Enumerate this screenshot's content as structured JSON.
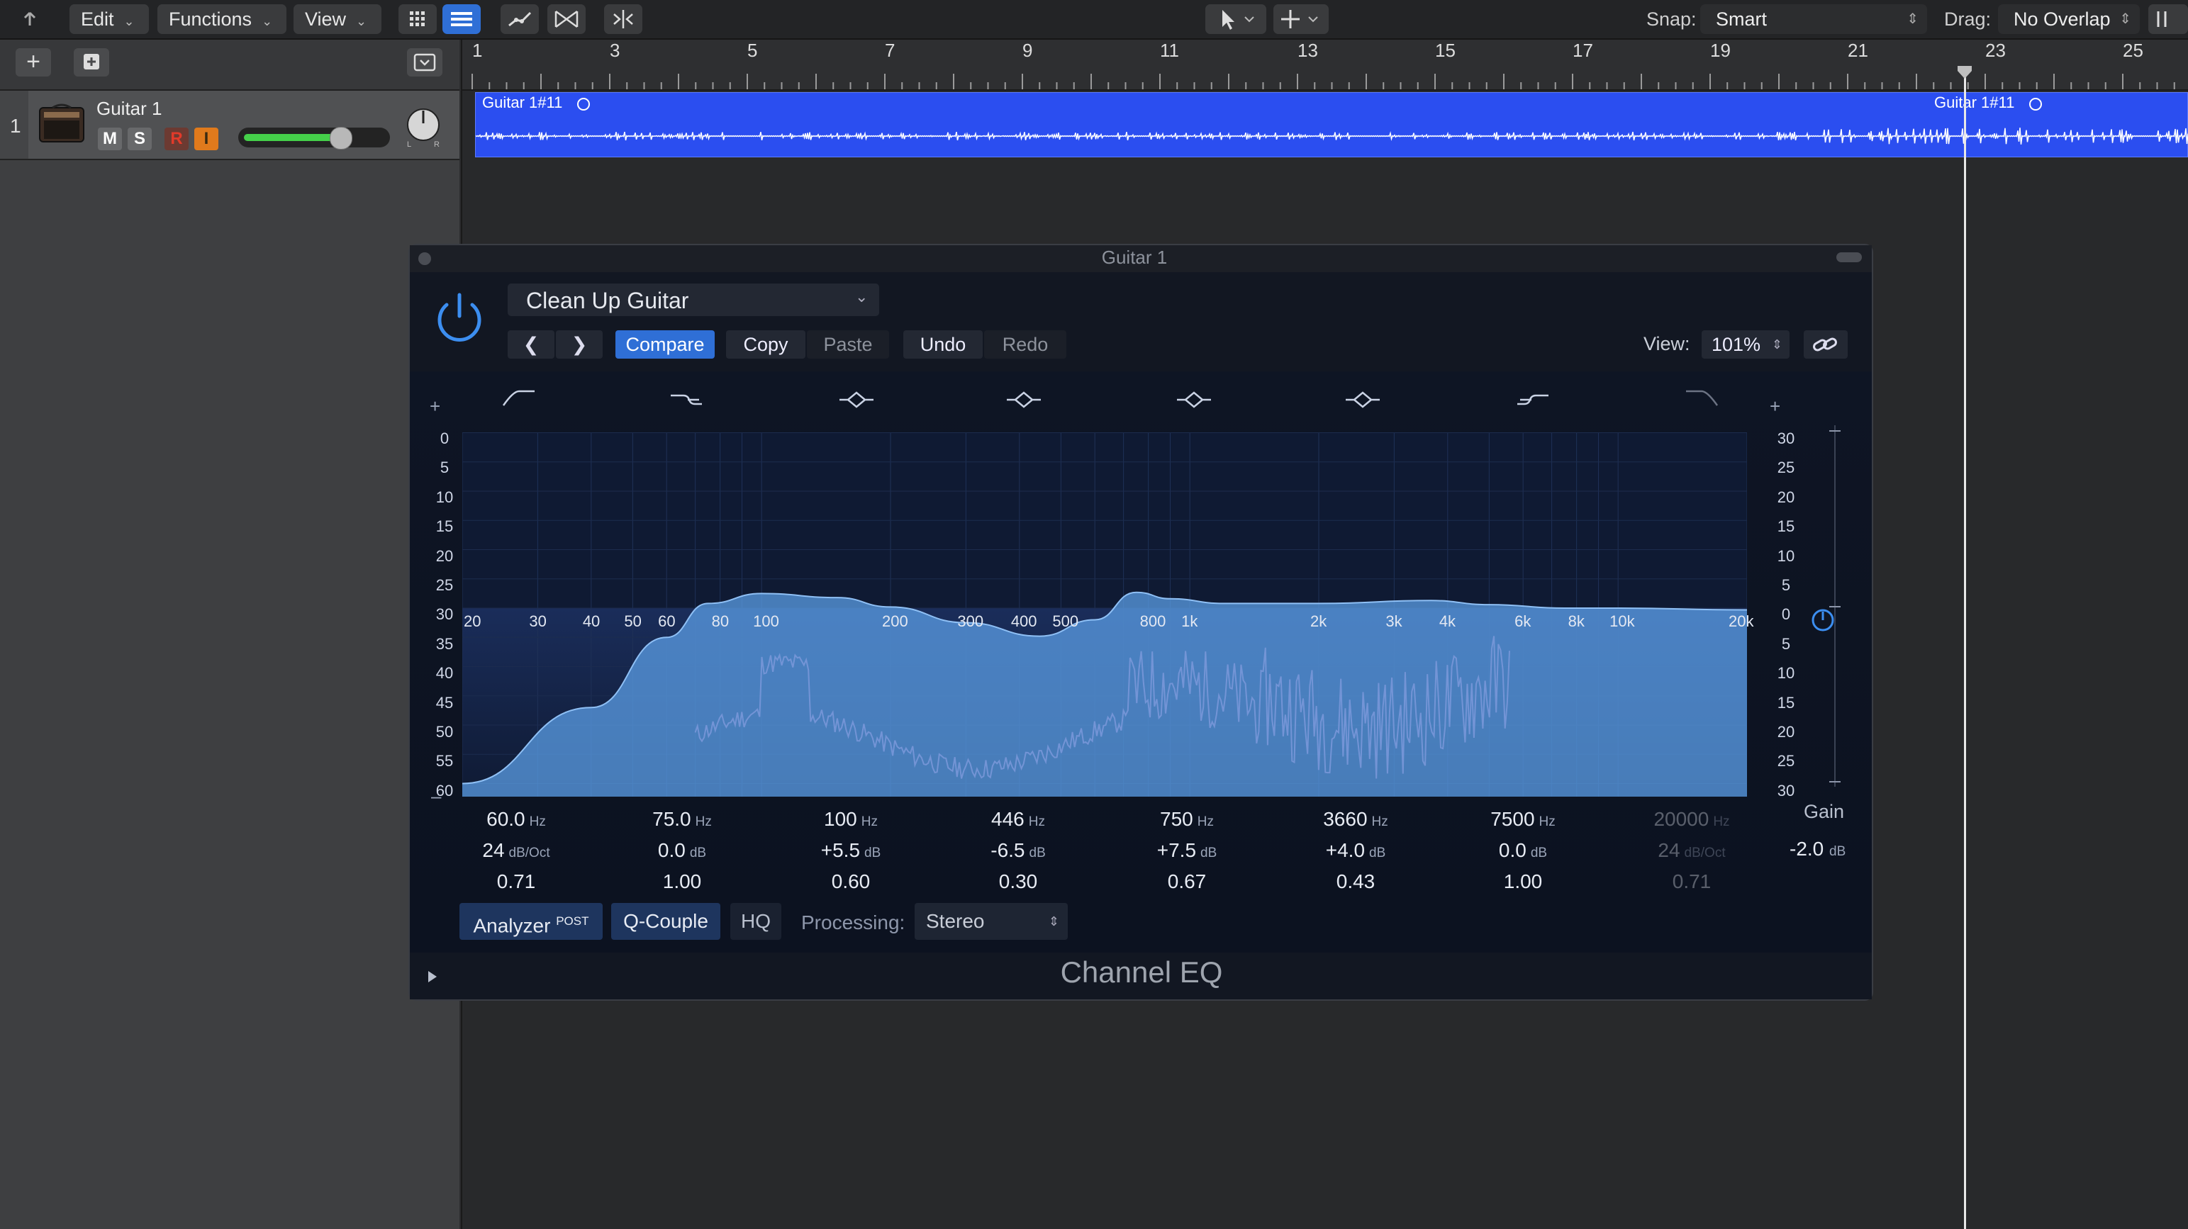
{
  "menubar": {
    "edit_label": "Edit",
    "functions_label": "Functions",
    "view_label": "View",
    "snap_label": "Snap:",
    "snap_value": "Smart",
    "drag_label": "Drag:",
    "drag_value": "No Overlap"
  },
  "ruler": {
    "bars": [
      "1",
      "3",
      "5",
      "7",
      "9",
      "11",
      "13",
      "15",
      "17",
      "19",
      "21",
      "23",
      "25"
    ]
  },
  "track": {
    "number": "1",
    "name": "Guitar 1",
    "mute": "M",
    "solo": "S",
    "record": "R",
    "input": "I",
    "volume_fraction": 0.72,
    "pan_label_l": "L",
    "pan_label_r": "R"
  },
  "region": {
    "name_a": "Guitar 1#11",
    "name_b": "Guitar 1#11",
    "color": "#2b4ef0"
  },
  "plugin": {
    "window_title": "Guitar 1",
    "preset_name": "Clean Up Guitar",
    "compare_label": "Compare",
    "copy_label": "Copy",
    "paste_label": "Paste",
    "undo_label": "Undo",
    "redo_label": "Redo",
    "view_label": "View:",
    "view_value": "101%",
    "plugin_name": "Channel EQ",
    "gain_label": "Gain",
    "gain_value": "-2.0",
    "gain_unit": "dB",
    "plus_left": "+",
    "plus_right": "+",
    "minus_left": "–",
    "accent_color": "#2f6fd6",
    "curve_color": "#5b9ee6",
    "analyzer_color": "#d98ab8"
  },
  "chart_data": {
    "type": "line",
    "title": "",
    "xlabel": "",
    "ylabel": "",
    "x_scale": "log",
    "x_ticks": [
      "20",
      "30",
      "40",
      "50",
      "60",
      "80",
      "100",
      "200",
      "300",
      "400",
      "500",
      "800",
      "1k",
      "2k",
      "3k",
      "4k",
      "6k",
      "8k",
      "10k",
      "20k"
    ],
    "left_y_ticks": [
      "0",
      "5",
      "10",
      "15",
      "20",
      "25",
      "30",
      "35",
      "40",
      "45",
      "50",
      "55",
      "60"
    ],
    "right_y_ticks": [
      "30",
      "25",
      "20",
      "15",
      "10",
      "5",
      "0",
      "5",
      "10",
      "15",
      "20",
      "25",
      "30"
    ],
    "right_y_range_db": [
      -30,
      30
    ],
    "series": [
      {
        "x": [
          20,
          40,
          60,
          75,
          100,
          150,
          200,
          300,
          446,
          600,
          750,
          900,
          1200,
          2000,
          3660,
          5000,
          7500,
          10000,
          20000
        ],
        "y": [
          -30,
          -17,
          -5,
          0.8,
          2.5,
          1.8,
          0.2,
          -2.5,
          -4.8,
          -2.0,
          2.7,
          1.6,
          0.8,
          0.8,
          1.3,
          0.6,
          0,
          0,
          -0.3
        ]
      }
    ]
  },
  "bands": [
    {
      "freq": "60.0",
      "freq_unit": "Hz",
      "gain": "24",
      "gain_unit": "dB/Oct",
      "q": "0.71",
      "active": true
    },
    {
      "freq": "75.0",
      "freq_unit": "Hz",
      "gain": "0.0",
      "gain_unit": "dB",
      "q": "1.00",
      "active": true
    },
    {
      "freq": "100",
      "freq_unit": "Hz",
      "gain": "+5.5",
      "gain_unit": "dB",
      "q": "0.60",
      "active": true
    },
    {
      "freq": "446",
      "freq_unit": "Hz",
      "gain": "-6.5",
      "gain_unit": "dB",
      "q": "0.30",
      "active": true
    },
    {
      "freq": "750",
      "freq_unit": "Hz",
      "gain": "+7.5",
      "gain_unit": "dB",
      "q": "0.67",
      "active": true
    },
    {
      "freq": "3660",
      "freq_unit": "Hz",
      "gain": "+4.0",
      "gain_unit": "dB",
      "q": "0.43",
      "active": true
    },
    {
      "freq": "7500",
      "freq_unit": "Hz",
      "gain": "0.0",
      "gain_unit": "dB",
      "q": "1.00",
      "active": true
    },
    {
      "freq": "20000",
      "freq_unit": "Hz",
      "gain": "24",
      "gain_unit": "dB/Oct",
      "q": "0.71",
      "active": false
    }
  ],
  "footer": {
    "analyzer_label": "Analyzer",
    "analyzer_sup": "POST",
    "qcouple_label": "Q-Couple",
    "hq_label": "HQ",
    "processing_label": "Processing:",
    "processing_value": "Stereo"
  }
}
